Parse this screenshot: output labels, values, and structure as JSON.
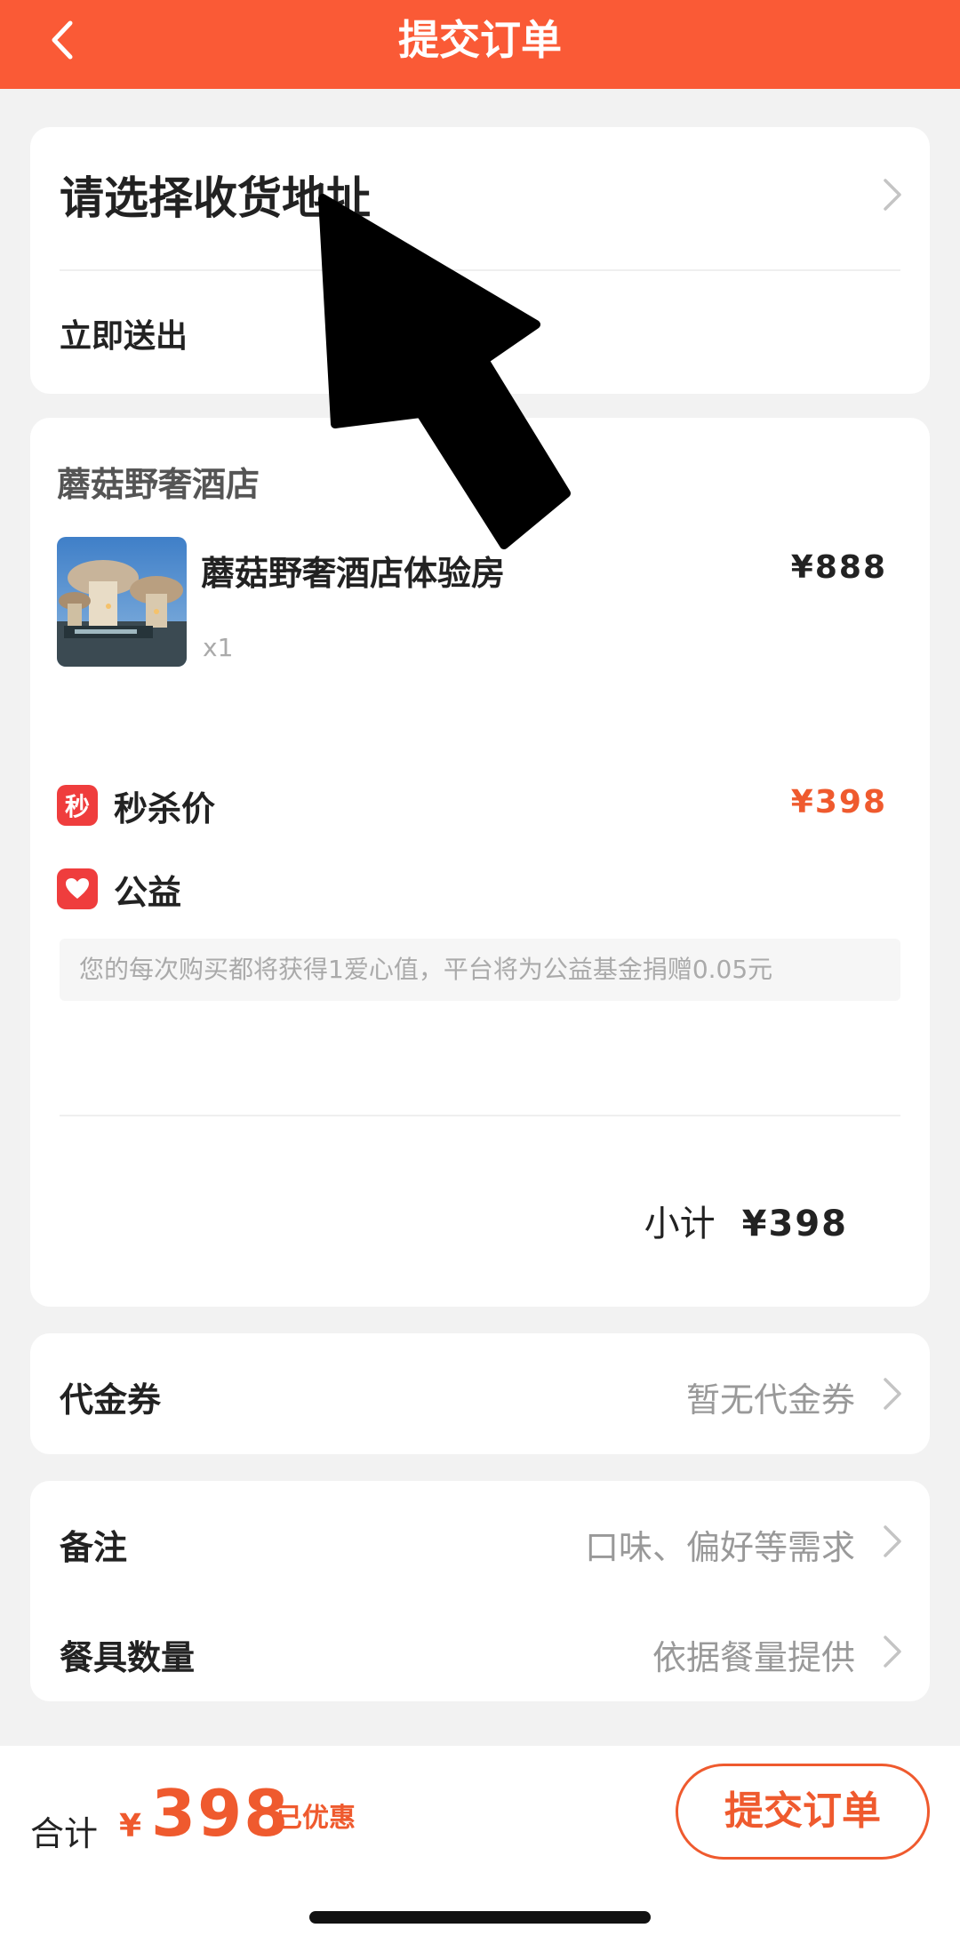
{
  "header": {
    "title": "提交订单",
    "bg_color": "#fa5a36"
  },
  "address": {
    "title": "请选择收货地址",
    "delivery": "立即送出"
  },
  "order": {
    "store": "蘑菇野奢酒店",
    "product": {
      "name": "蘑菇野奢酒店体验房",
      "price": "¥888",
      "quantity": "x1"
    },
    "seckill": {
      "badge": "秒",
      "label": "秒杀价",
      "price": "¥398"
    },
    "charity": {
      "label": "公益",
      "notice": "您的每次购买都将获得1爱心值，平台将为公益基金捐赠0.05元"
    },
    "subtotal": {
      "label": "小计",
      "value": "¥398"
    }
  },
  "voucher": {
    "label": "代金券",
    "value": "暂无代金券"
  },
  "remarks": {
    "note_label": "备注",
    "note_placeholder": "口味、偏好等需求",
    "tableware_label": "餐具数量",
    "tableware_value": "依据餐量提供"
  },
  "footer": {
    "total_label": "合计",
    "currency": "¥",
    "total_amount": "398",
    "discount_label": "已优惠",
    "submit_label": "提交订单"
  },
  "colors": {
    "accent": "#ef5a2e",
    "badge_red": "#ef3d3d"
  },
  "icons": [
    "back-arrow-icon",
    "chevron-right-icon",
    "seckill-badge-icon",
    "heart-icon",
    "cursor-arrow-icon"
  ]
}
